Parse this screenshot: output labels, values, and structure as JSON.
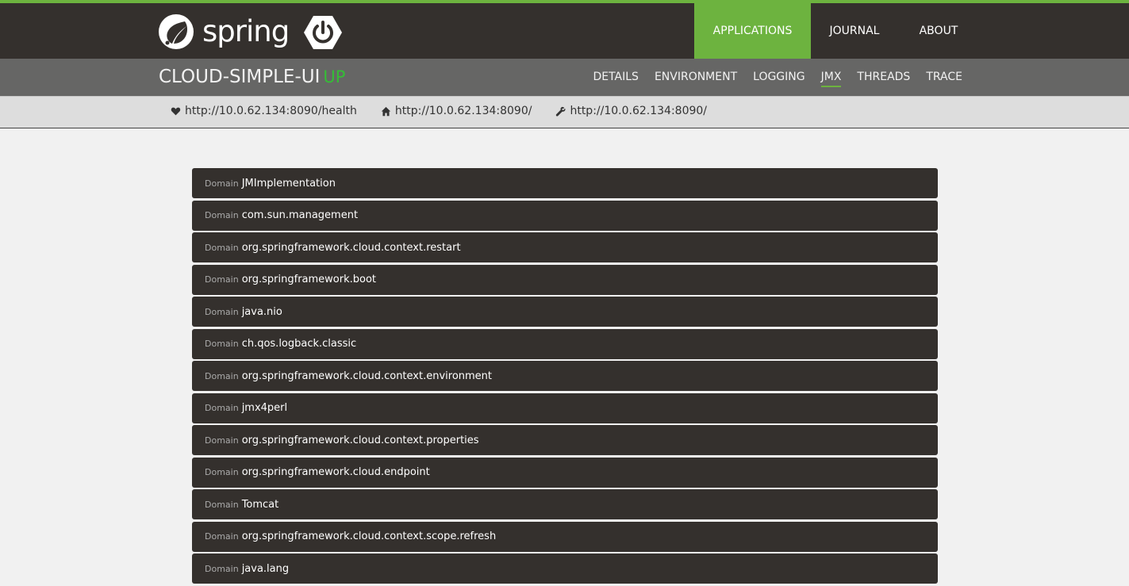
{
  "brand": {
    "logo_text": "spring",
    "logo_icon": "spring-leaf-icon",
    "boot_icon": "power-icon",
    "accent": "#6db33f"
  },
  "topnav": [
    {
      "label": "APPLICATIONS",
      "active": true
    },
    {
      "label": "JOURNAL",
      "active": false
    },
    {
      "label": "ABOUT",
      "active": false
    }
  ],
  "app": {
    "name": "CLOUD-SIMPLE-UI",
    "status": "UP",
    "status_color": "#34be36"
  },
  "subnav": [
    {
      "label": "DETAILS",
      "active": false
    },
    {
      "label": "ENVIRONMENT",
      "active": false
    },
    {
      "label": "LOGGING",
      "active": false
    },
    {
      "label": "JMX",
      "active": true
    },
    {
      "label": "THREADS",
      "active": false
    },
    {
      "label": "TRACE",
      "active": false
    }
  ],
  "urls": [
    {
      "icon": "heart-icon",
      "text": "http://10.0.62.134:8090/health"
    },
    {
      "icon": "home-icon",
      "text": "http://10.0.62.134:8090/"
    },
    {
      "icon": "wrench-icon",
      "text": "http://10.0.62.134:8090/"
    }
  ],
  "domain_label": "Domain",
  "domains": [
    "JMImplementation",
    "com.sun.management",
    "org.springframework.cloud.context.restart",
    "org.springframework.boot",
    "java.nio",
    "ch.qos.logback.classic",
    "org.springframework.cloud.context.environment",
    "jmx4perl",
    "org.springframework.cloud.context.properties",
    "org.springframework.cloud.endpoint",
    "Tomcat",
    "org.springframework.cloud.context.scope.refresh",
    "java.lang"
  ]
}
